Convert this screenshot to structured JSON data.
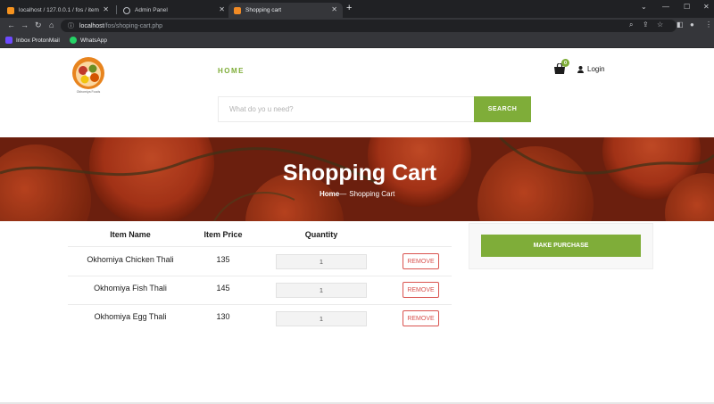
{
  "browser": {
    "tabs": [
      {
        "title": "localhost / 127.0.0.1 / fos / item",
        "favicon_color": "#f7931e"
      },
      {
        "title": "Admin Panel",
        "favicon_color": "#bdc1c6"
      },
      {
        "title": "Shopping cart",
        "favicon_color": "#f28b25"
      }
    ],
    "new_tab_label": "+",
    "url_host": "localhost",
    "url_path": "/fos/shoping-cart.php",
    "bookmarks": [
      {
        "label": "Inbox ProtonMail",
        "icon_color": "#6d4aff"
      },
      {
        "label": "WhatsApp",
        "icon_color": "#25d366"
      }
    ]
  },
  "header": {
    "logo_caption": "Okhomiya Foods",
    "nav_home": "HOME",
    "cart_count": "0",
    "login_label": "Login",
    "search_placeholder": "What do yo u need?",
    "search_button": "SEARCH"
  },
  "hero": {
    "title": "Shopping Cart",
    "breadcrumb_home": "Home",
    "breadcrumb_sep": "—",
    "breadcrumb_current": "Shopping Cart"
  },
  "cart": {
    "columns": [
      "Item Name",
      "Item Price",
      "Quantity"
    ],
    "rows": [
      {
        "name": "Okhomiya Chicken Thali",
        "price": "135",
        "quantity": "1",
        "action": "REMOVE"
      },
      {
        "name": "Okhomiya Fish Thali",
        "price": "145",
        "quantity": "1",
        "action": "REMOVE"
      },
      {
        "name": "Okhomiya Egg Thali",
        "price": "130",
        "quantity": "1",
        "action": "REMOVE"
      }
    ]
  },
  "checkout": {
    "button_label": "MAKE PURCHASE"
  },
  "colors": {
    "accent": "#7fad39",
    "remove": "#d9534f",
    "hero_bg": "#8e2a12"
  }
}
